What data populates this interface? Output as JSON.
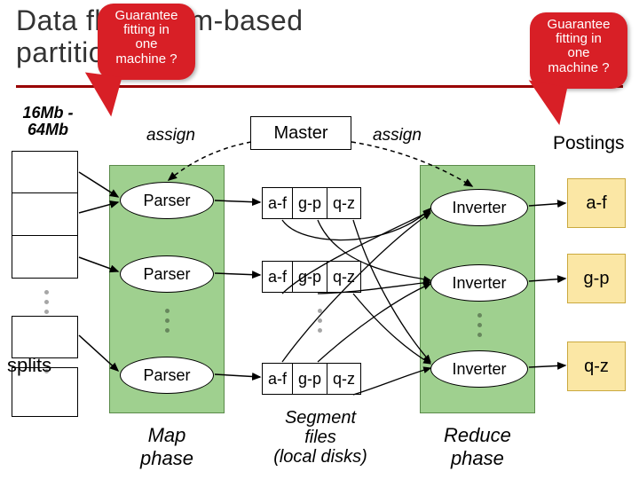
{
  "title_line1": "Data flow: term-based",
  "title_line2": "partitioning",
  "sizes_line1": "16Mb -",
  "sizes_line2": "64Mb",
  "splits_label": "splits",
  "assign_left": "assign",
  "assign_right": "assign",
  "master_label": "Master",
  "parser_label": "Parser",
  "inverter_label": "Inverter",
  "postings_label": "Postings",
  "map_phase_l1": "Map",
  "map_phase_l2": "phase",
  "reduce_phase_l1": "Reduce",
  "reduce_phase_l2": "phase",
  "segfiles_l1": "Segment",
  "segfiles_l2": "files",
  "segfiles_l3": "(local disks)",
  "seg_cells": [
    "a-f",
    "g-p",
    "q-z"
  ],
  "posting_ranges": [
    "a-f",
    "g-p",
    "q-z"
  ],
  "callout_l1": "Guarantee",
  "callout_l2": "fitting in",
  "callout_l3": "one",
  "callout_l4": "machine ?",
  "colors": {
    "rule": "#990000",
    "green": "#9fd08f",
    "red": "#d81f26",
    "yellow": "#fbe7a5"
  }
}
